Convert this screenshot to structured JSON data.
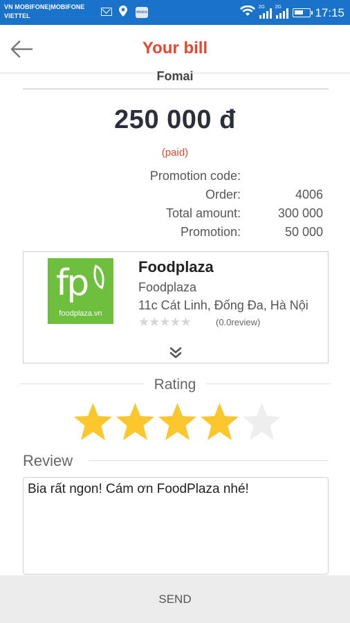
{
  "status_bar": {
    "carrier_line1": "VN MOBIFONE|MOBIFONE",
    "carrier_line2": "VIETTEL",
    "app_badge": "moco",
    "net1": "2G",
    "net2": "2G",
    "time": "17:15"
  },
  "header": {
    "title": "Your bill"
  },
  "bill": {
    "merchant_partial": "Fomai",
    "amount": "250 000 đ",
    "status": "(paid)",
    "details": [
      {
        "label": "Promotion code:",
        "value": ""
      },
      {
        "label": "Order:",
        "value": "4006"
      },
      {
        "label": "Total amount:",
        "value": "300 000"
      },
      {
        "label": "Promotion:",
        "value": "50 000"
      }
    ]
  },
  "shop": {
    "logo_text": "fp",
    "logo_domain": "foodplaza.vn",
    "name": "Foodplaza",
    "subtitle": "Foodplaza",
    "address": "11c Cát Linh, Đống Đa, Hà Nội",
    "review_count": "(0.0review)",
    "mini_stars": "★★★★★"
  },
  "rating": {
    "label": "Rating",
    "value": 4,
    "max": 5
  },
  "review": {
    "label": "Review",
    "text": "Bia rất ngon! Cám ơn FoodPlaza nhé!"
  },
  "send_label": "SEND",
  "colors": {
    "status_bar": "#1a73c9",
    "accent": "#e8452c",
    "star_on": "#fcc72c",
    "star_off": "#eeeeee",
    "logo_green": "#6fbf3f"
  }
}
